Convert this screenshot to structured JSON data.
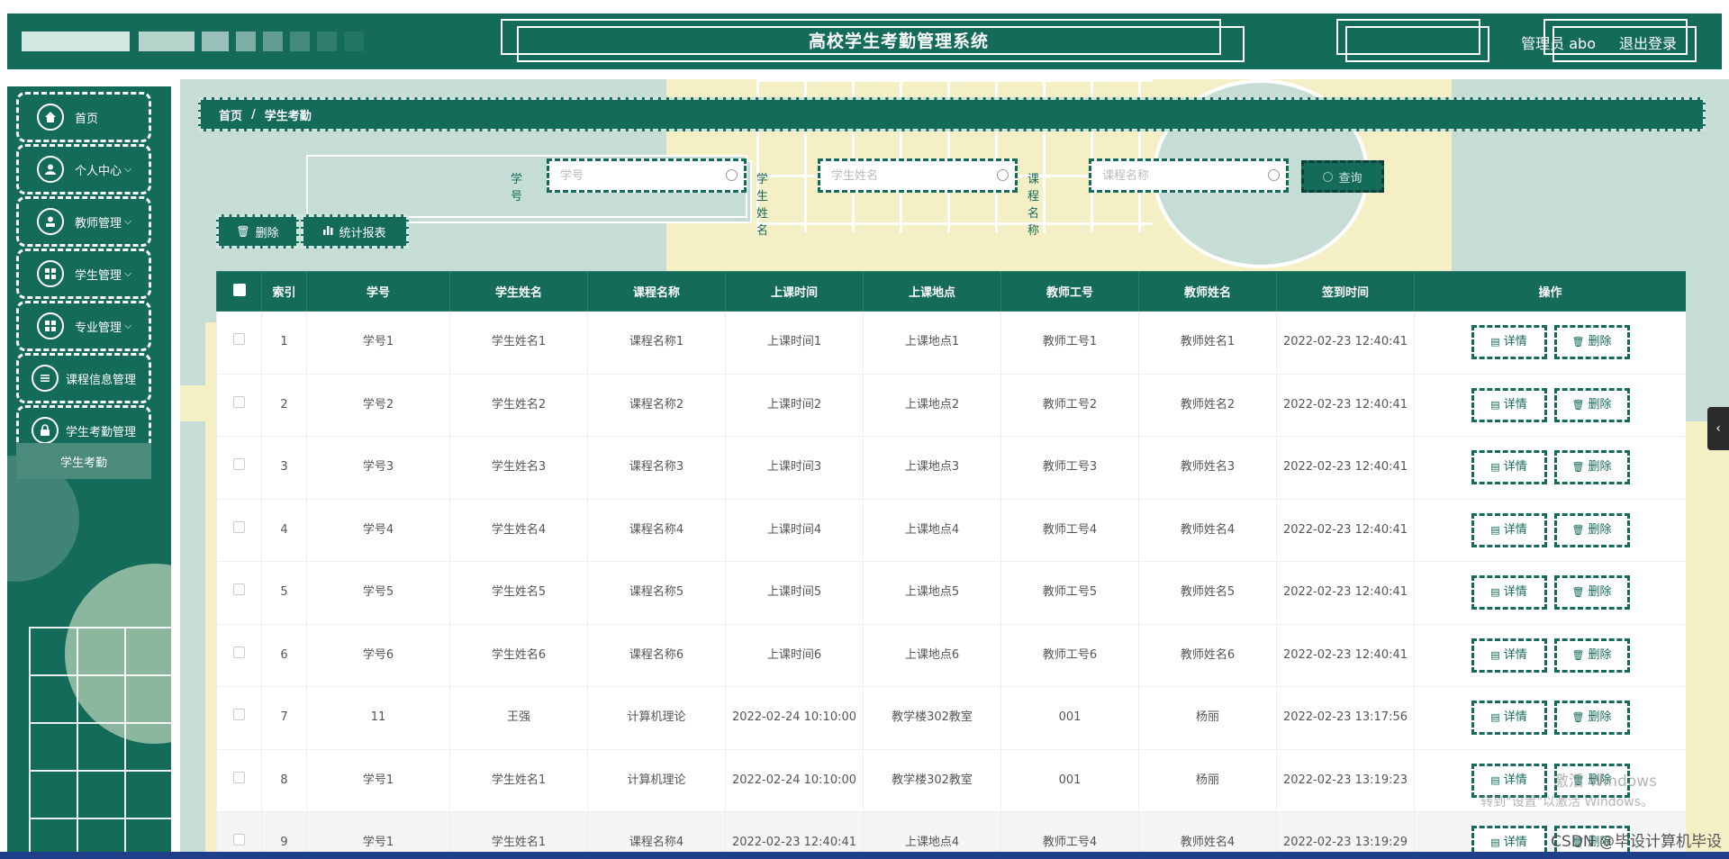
{
  "header": {
    "title": "高校学生考勤管理系统",
    "user": "管理员 abo",
    "logout": "退出登录"
  },
  "sidebar": {
    "items": [
      {
        "label": "首页",
        "icon": "home-icon",
        "has_children": false
      },
      {
        "label": "个人中心",
        "icon": "user-icon",
        "has_children": true
      },
      {
        "label": "教师管理",
        "icon": "person-icon",
        "has_children": true
      },
      {
        "label": "学生管理",
        "icon": "grid-icon",
        "has_children": true
      },
      {
        "label": "专业管理",
        "icon": "grid-icon",
        "has_children": true
      },
      {
        "label": "课程信息管理",
        "icon": "list-icon",
        "has_children": false
      },
      {
        "label": "学生考勤管理",
        "icon": "lock-icon",
        "has_children": false
      }
    ],
    "submenu_active": "学生考勤",
    "chevron": "⌵"
  },
  "breadcrumb": {
    "home": "首页",
    "separator": "/",
    "current": "学生考勤"
  },
  "search": {
    "student_no_label": "学号",
    "student_no_placeholder": "学号",
    "student_name_label": "学生姓名",
    "student_name_placeholder": "学生姓名",
    "course_label": "课程名称",
    "course_placeholder": "课程名称",
    "button": "查询"
  },
  "actions": {
    "delete": "删除",
    "report": "统计报表"
  },
  "table": {
    "headers": [
      "",
      "索引",
      "学号",
      "学生姓名",
      "课程名称",
      "上课时间",
      "上课地点",
      "教师工号",
      "教师姓名",
      "签到时间",
      "操作"
    ],
    "detail_label": "详情",
    "delete_label": "删除",
    "rows": [
      [
        "1",
        "学号1",
        "学生姓名1",
        "课程名称1",
        "上课时间1",
        "上课地点1",
        "教师工号1",
        "教师姓名1",
        "2022-02-23 12:40:41"
      ],
      [
        "2",
        "学号2",
        "学生姓名2",
        "课程名称2",
        "上课时间2",
        "上课地点2",
        "教师工号2",
        "教师姓名2",
        "2022-02-23 12:40:41"
      ],
      [
        "3",
        "学号3",
        "学生姓名3",
        "课程名称3",
        "上课时间3",
        "上课地点3",
        "教师工号3",
        "教师姓名3",
        "2022-02-23 12:40:41"
      ],
      [
        "4",
        "学号4",
        "学生姓名4",
        "课程名称4",
        "上课时间4",
        "上课地点4",
        "教师工号4",
        "教师姓名4",
        "2022-02-23 12:40:41"
      ],
      [
        "5",
        "学号5",
        "学生姓名5",
        "课程名称5",
        "上课时间5",
        "上课地点5",
        "教师工号5",
        "教师姓名5",
        "2022-02-23 12:40:41"
      ],
      [
        "6",
        "学号6",
        "学生姓名6",
        "课程名称6",
        "上课时间6",
        "上课地点6",
        "教师工号6",
        "教师姓名6",
        "2022-02-23 12:40:41"
      ],
      [
        "7",
        "11",
        "王强",
        "计算机理论",
        "2022-02-24 10:10:00",
        "教学楼302教室",
        "001",
        "杨丽",
        "2022-02-23 13:17:56"
      ],
      [
        "8",
        "学号1",
        "学生姓名1",
        "计算机理论",
        "2022-02-24 10:10:00",
        "教学楼302教室",
        "001",
        "杨丽",
        "2022-02-23 13:19:23"
      ],
      [
        "9",
        "学号1",
        "学生姓名1",
        "课程名称4",
        "2022-02-23 12:40:41",
        "上课地点4",
        "教师工号4",
        "教师姓名4",
        "2022-02-23 13:19:29"
      ]
    ]
  },
  "overlay": {
    "side_tab": "‹",
    "watermark_title": "激活 Windows",
    "watermark_sub": "转到\"设置\"以激活 Windows。",
    "csdn": "CSDN @毕设计算机毕设"
  },
  "colors": {
    "primary": "#146b5a",
    "bg_yellow": "#f5efc6",
    "bg_green": "#c5ddd4"
  }
}
